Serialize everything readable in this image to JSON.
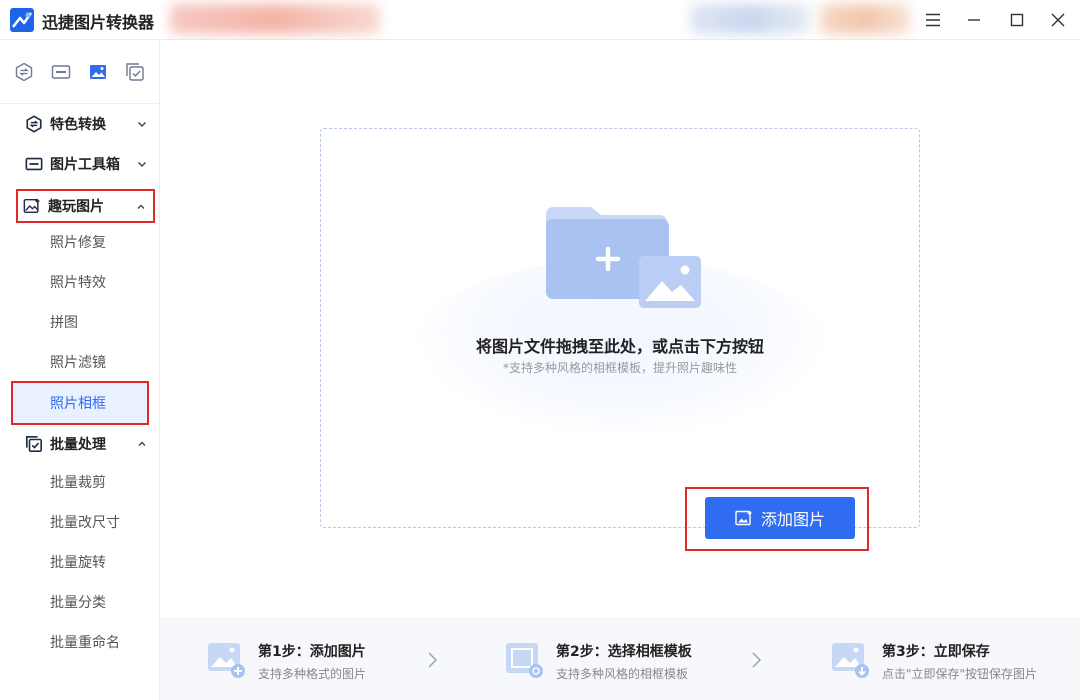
{
  "app": {
    "title": "迅捷图片转换器"
  },
  "colors": {
    "accent": "#2f6cf0",
    "highlight_frame": "#e02a2a",
    "active_bg": "#e9f0ff"
  },
  "sidebar": {
    "tool_icons": [
      "convert-icon",
      "toolbox-icon",
      "image-icon",
      "batch-icon"
    ],
    "categories": [
      {
        "label": "特色转换",
        "icon": "convert-icon",
        "expanded": false
      },
      {
        "label": "图片工具箱",
        "icon": "toolbox-icon",
        "expanded": false
      },
      {
        "label": "趣玩图片",
        "icon": "image-fun-icon",
        "expanded": true,
        "items": [
          "照片修复",
          "照片特效",
          "拼图",
          "照片滤镜",
          "照片相框"
        ]
      },
      {
        "label": "批量处理",
        "icon": "batch-icon",
        "expanded": true,
        "items": [
          "批量裁剪",
          "批量改尺寸",
          "批量旋转",
          "批量分类",
          "批量重命名"
        ]
      }
    ],
    "active_item": "照片相框"
  },
  "main": {
    "drop_title": "将图片文件拖拽至此处，或点击下方按钮",
    "drop_hint": "*支持多种风格的相框模板，提升照片趣味性",
    "add_button": "添加图片"
  },
  "steps": [
    {
      "title": "第1步：添加图片",
      "desc": "支持多种格式的图片",
      "icon": "add-image-icon"
    },
    {
      "title": "第2步：选择相框模板",
      "desc": "支持多种风格的相框模板",
      "icon": "frame-template-icon"
    },
    {
      "title": "第3步：立即保存",
      "desc": "点击\"立即保存\"按钮保存图片",
      "icon": "save-image-icon"
    }
  ]
}
